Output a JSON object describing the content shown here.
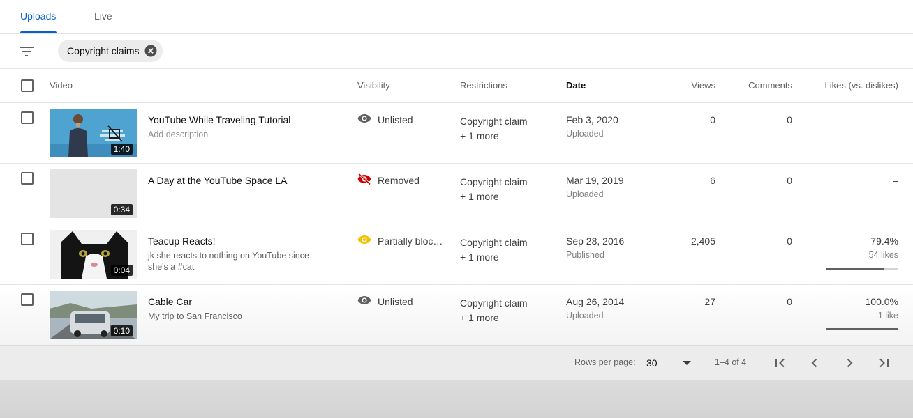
{
  "tabs": [
    {
      "label": "Uploads",
      "active": true
    },
    {
      "label": "Live",
      "active": false
    }
  ],
  "filter": {
    "chip_label": "Copyright claims",
    "icon": "filter-icon"
  },
  "table": {
    "headers": {
      "video": "Video",
      "visibility": "Visibility",
      "restrictions": "Restrictions",
      "date": "Date",
      "views": "Views",
      "comments": "Comments",
      "likes": "Likes (vs. dislikes)"
    },
    "rows": [
      {
        "title": "YouTube While Traveling Tutorial",
        "description": "Add description",
        "duration": "1:40",
        "visibility": "Unlisted",
        "visibility_icon": "eye-icon",
        "restriction": "Copyright claim",
        "restriction_more": "+ 1 more",
        "date": "Feb 3, 2020",
        "status": "Uploaded",
        "views": "0",
        "comments": "0",
        "likes": "–",
        "likes_sub": ""
      },
      {
        "title": "A Day at the YouTube Space LA",
        "description": "",
        "duration": "0:34",
        "visibility": "Removed",
        "visibility_icon": "eye-off-icon",
        "restriction": "Copyright claim",
        "restriction_more": "+ 1 more",
        "date": "Mar 19, 2019",
        "status": "Uploaded",
        "views": "6",
        "comments": "0",
        "likes": "–",
        "likes_sub": ""
      },
      {
        "title": "Teacup Reacts!",
        "description": "jk she reacts to nothing on YouTube since she's a #cat",
        "duration": "0:04",
        "visibility": "Partially blocked",
        "visibility_icon": "eye-icon",
        "restriction": "Copyright claim",
        "restriction_more": "+ 1 more",
        "date": "Sep 28, 2016",
        "status": "Published",
        "views": "2,405",
        "comments": "0",
        "likes": "79.4%",
        "likes_sub": "54 likes",
        "like_ratio": 0.794
      },
      {
        "title": "Cable Car",
        "description": "My trip to San Francisco",
        "duration": "0:10",
        "visibility": "Unlisted",
        "visibility_icon": "eye-icon",
        "restriction": "Copyright claim",
        "restriction_more": "+ 1 more",
        "date": "Aug 26, 2014",
        "status": "Uploaded",
        "views": "27",
        "comments": "0",
        "likes": "100.0%",
        "likes_sub": "1 like",
        "like_ratio": 1.0
      }
    ]
  },
  "pagination": {
    "rows_per_page_label": "Rows per page:",
    "rows_per_page": "30",
    "range": "1–4 of 4"
  },
  "colors": {
    "accent": "#065fd4",
    "removed": "#cc0000",
    "partial": "#f2c200",
    "neutral_icon": "#606060"
  }
}
